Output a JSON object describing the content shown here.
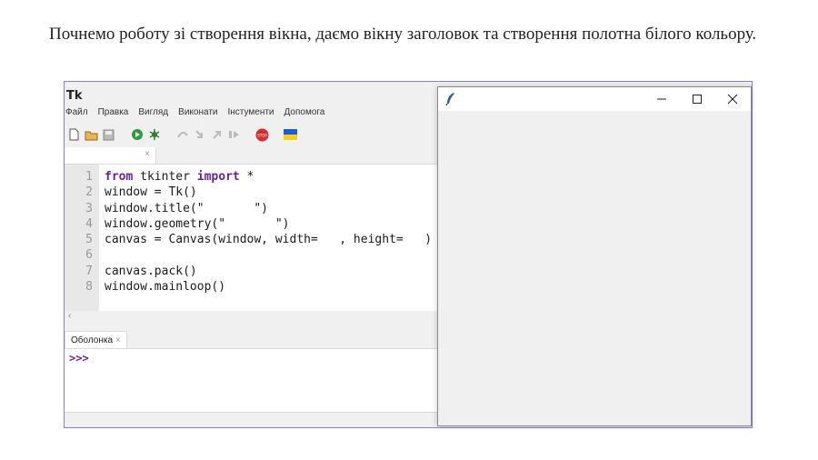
{
  "intro": {
    "text": "Почнемо роботу зі створення вікна, даємо вікну заголовок та створення полотна білого кольору."
  },
  "ide": {
    "menu": [
      "Файл",
      "Правка",
      "Вигляд",
      "Виконати",
      "Інстументи",
      "Допомога"
    ],
    "toolbar_icons": [
      "new-file-icon",
      "open-folder-icon",
      "save-icon",
      "run-icon",
      "debug-icon",
      "step-over-icon",
      "step-into-icon",
      "step-out-icon",
      "resume-icon",
      "stop-icon",
      "ukraine-flag-icon"
    ],
    "editor_tab": {
      "close": "×"
    },
    "line_numbers": [
      "1",
      "2",
      "3",
      "4",
      "5",
      "6",
      "7",
      "8"
    ],
    "code": {
      "l1_kw1": "from",
      "l1_mid": " tkinter ",
      "l1_kw2": "import",
      "l1_end": " *",
      "l2": "window = Tk()",
      "l3": "window.title(\"       \")",
      "l4": "window.geometry(\"       \")",
      "l5": "canvas = Canvas(window, width=   , height=   )",
      "l6": "",
      "l7": "canvas.pack()",
      "l8": "window.mainloop()"
    },
    "hscroll_left": "‹",
    "shell_tab": {
      "label": "Оболонка",
      "close": "×"
    },
    "prompt": ">>>"
  },
  "tk_window": {
    "minimize": "–",
    "maximize": "☐",
    "close": "✕"
  },
  "colors": {
    "keyword": "#6a1fa0",
    "frame_border": "#8c7cc2",
    "stop": "#d32f2f",
    "run": "#2e9c3a"
  }
}
